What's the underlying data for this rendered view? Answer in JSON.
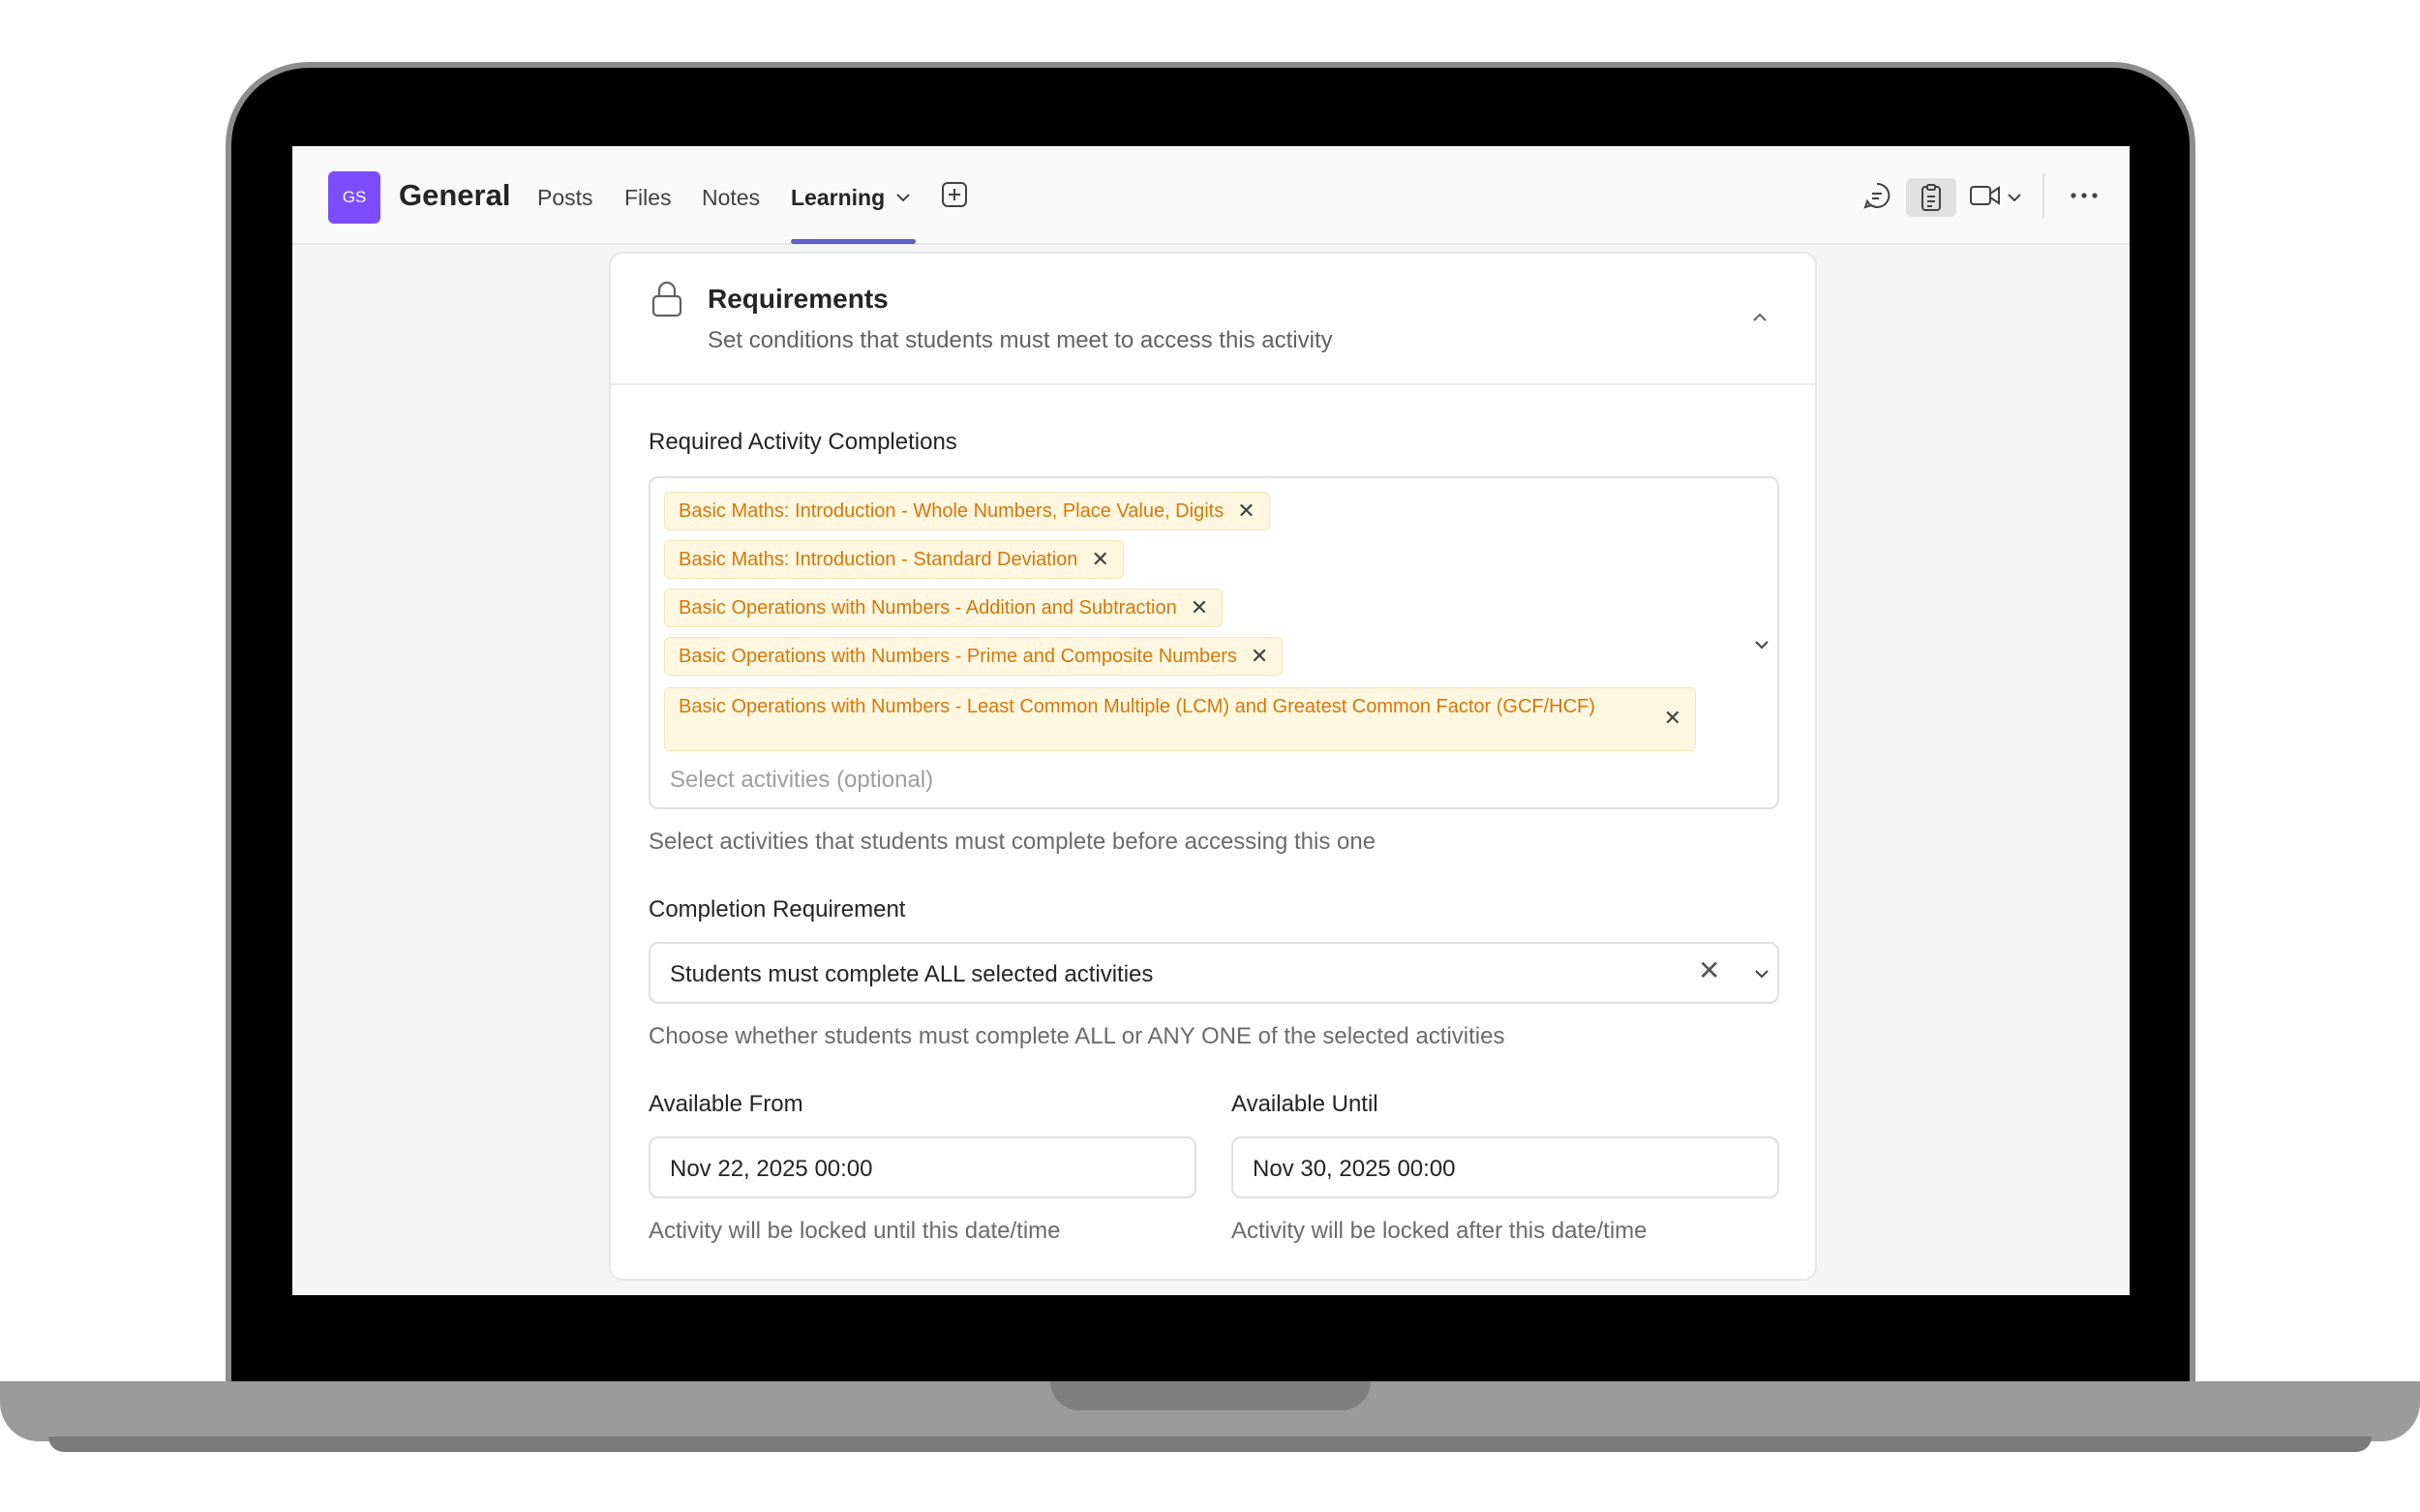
{
  "header": {
    "team_initials": "GS",
    "channel_name": "General",
    "tabs": [
      {
        "label": "Posts",
        "active": false
      },
      {
        "label": "Files",
        "active": false
      },
      {
        "label": "Notes",
        "active": false
      },
      {
        "label": "Learning",
        "active": true
      }
    ],
    "accent_color": "#5b5fc7",
    "avatar_color": "#7c4dff",
    "icons": [
      "chevron-down-icon",
      "add-tab-icon",
      "chat-icon",
      "clipboard-icon",
      "video-camera-icon",
      "more-options-icon"
    ]
  },
  "requirements": {
    "title": "Requirements",
    "subtitle": "Set conditions that students must meet to access this activity",
    "activity_completions": {
      "label": "Required Activity Completions",
      "selected": [
        "Basic Maths: Introduction - Whole Numbers, Place Value, Digits",
        "Basic Maths: Introduction - Standard Deviation",
        "Basic Operations with Numbers - Addition and Subtraction",
        "Basic Operations with Numbers - Prime and Composite Numbers",
        "Basic Operations with Numbers - Least Common Multiple (LCM) and Greatest Common Factor (GCF/HCF)"
      ],
      "placeholder": "Select activities (optional)",
      "help": "Select activities that students must complete before accessing this one",
      "chip_color": "#d4780a"
    },
    "completion_requirement": {
      "label": "Completion Requirement",
      "value": "Students must complete ALL selected activities",
      "help": "Choose whether students must complete ALL or ANY ONE of the selected activities"
    },
    "available_from": {
      "label": "Available From",
      "value": "Nov 22, 2025 00:00",
      "help": "Activity will be locked until this date/time"
    },
    "available_until": {
      "label": "Available Until",
      "value": "Nov 30, 2025 00:00",
      "help": "Activity will be locked after this date/time"
    }
  }
}
